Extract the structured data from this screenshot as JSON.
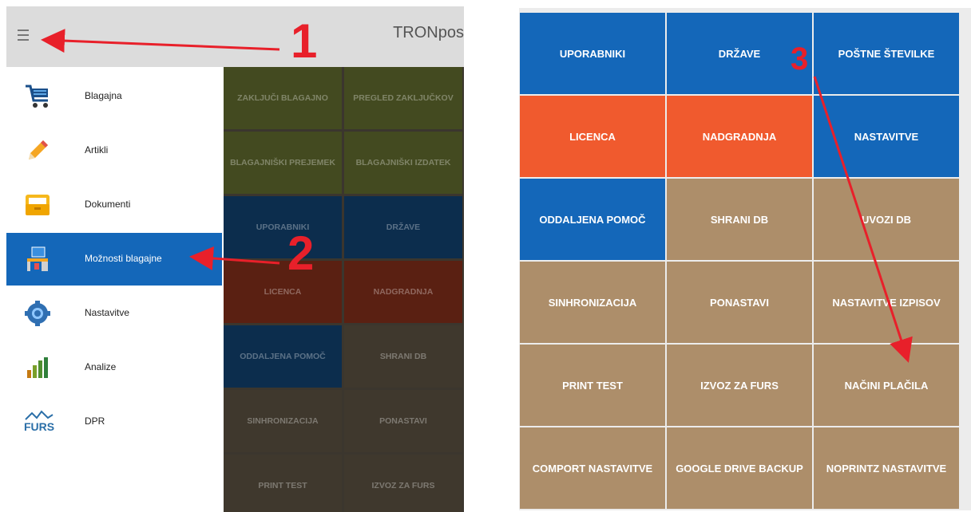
{
  "app": {
    "title": "TRONpos"
  },
  "colors": {
    "blue": "#1467b9",
    "orange": "#f05a2e",
    "tan": "#ad8e6a",
    "arrow": "#e8202a",
    "dim_olive": "#434a20",
    "dim_navy": "#0c2d4d",
    "dim_red": "#5a2012",
    "dim_brown": "#3f382d"
  },
  "drawer": {
    "items": [
      {
        "label": "Blagajna",
        "icon": "cart-icon"
      },
      {
        "label": "Artikli",
        "icon": "pencil-icon"
      },
      {
        "label": "Dokumenti",
        "icon": "folder-icon"
      },
      {
        "label": "Možnosti blagajne",
        "icon": "cashier-desk-icon",
        "selected": true
      },
      {
        "label": "Nastavitve",
        "icon": "gear-icon"
      },
      {
        "label": "Analize",
        "icon": "bar-chart-icon"
      },
      {
        "label": "DPR",
        "icon": "furs-logo-icon",
        "logo_text": "FURS"
      }
    ]
  },
  "background_grid": {
    "tiles": [
      [
        "ZAKLJUČI BLAGAJNO",
        "PREGLED ZAKLJUČKOV"
      ],
      [
        "BLAGAJNIŠKI PREJEMEK",
        "BLAGAJNIŠKI IZDATEK"
      ],
      [
        "UPORABNIKI",
        "DRŽAVE"
      ],
      [
        "LICENCA",
        "NADGRADNJA"
      ],
      [
        "ODDALJENA POMOČ",
        "SHRANI DB"
      ],
      [
        "SINHRONIZACIJA",
        "PONASTAVI"
      ],
      [
        "PRINT TEST",
        "IZVOZ ZA FURS"
      ]
    ]
  },
  "options_grid": {
    "tiles": [
      [
        "UPORABNIKI",
        "DRŽAVE",
        "POŠTNE ŠTEVILKE"
      ],
      [
        "LICENCA",
        "NADGRADNJA",
        "NASTAVITVE"
      ],
      [
        "ODDALJENA POMOČ",
        "SHRANI DB",
        "UVOZI DB"
      ],
      [
        "SINHRONIZACIJA",
        "PONASTAVI",
        "NASTAVITVE IZPISOV"
      ],
      [
        "PRINT TEST",
        "IZVOZ ZA FURS",
        "NAČINI PLAČILA"
      ],
      [
        "COMPORT NASTAVITVE",
        "GOOGLE DRIVE BACKUP",
        "NOPRINTZ NASTAVITVE"
      ]
    ]
  },
  "annotations": {
    "step1": "1",
    "step2": "2",
    "step3": "3"
  }
}
